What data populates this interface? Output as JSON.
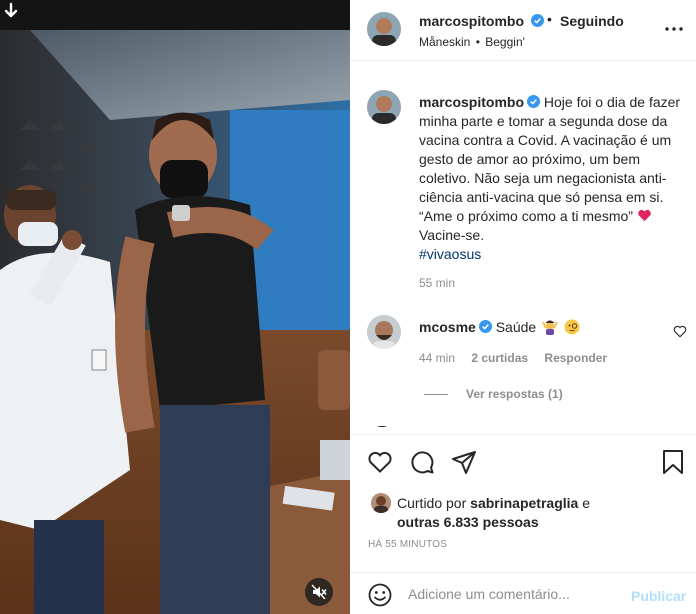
{
  "post": {
    "username": "marcospitombo",
    "follow_status": "Seguindo",
    "dot": "•",
    "music_artist": "Måneskin",
    "music_sep": "•",
    "music_track": "Beggin'",
    "more_icon": "more-horizontal-icon"
  },
  "caption": {
    "username": "marcospitombo",
    "text": "Hoje foi o dia de fazer minha parte e tomar a segunda dose da vacina contra a Covid. A vacinação é um gesto de amor ao próximo, um bem coletivo. Não seja um negacionista anti-ciência anti-vacina que só pensa em si. “Ame o próximo como a ti mesmo”",
    "text_after_emoji": "Vacine-se.",
    "hashtag": "#vivaosus",
    "time": "55 min"
  },
  "comment": {
    "username": "mcosme",
    "text": "Saúde",
    "time": "44 min",
    "likes": "2 curtidas",
    "reply_label": "Responder",
    "view_replies": "Ver respostas (1)"
  },
  "likes": {
    "prefix": "Curtido por",
    "user": "sabrinapetraglia",
    "connector": "e",
    "others": "outras 6.833 pessoas"
  },
  "time_ago": "HÁ 55 MINUTOS",
  "add_comment": {
    "placeholder": "Adicione um comentário...",
    "post_label": "Publicar"
  },
  "colors": {
    "verified": "#3897f0",
    "heart": "#ed4956",
    "link": "#00376b",
    "secondary_text": "#8e8e8e",
    "post_button_disabled": "#b2dffc"
  },
  "icons": [
    "download-arrow-icon",
    "mute-icon",
    "heart-icon",
    "comment-icon",
    "share-icon",
    "bookmark-icon",
    "smile-icon"
  ]
}
